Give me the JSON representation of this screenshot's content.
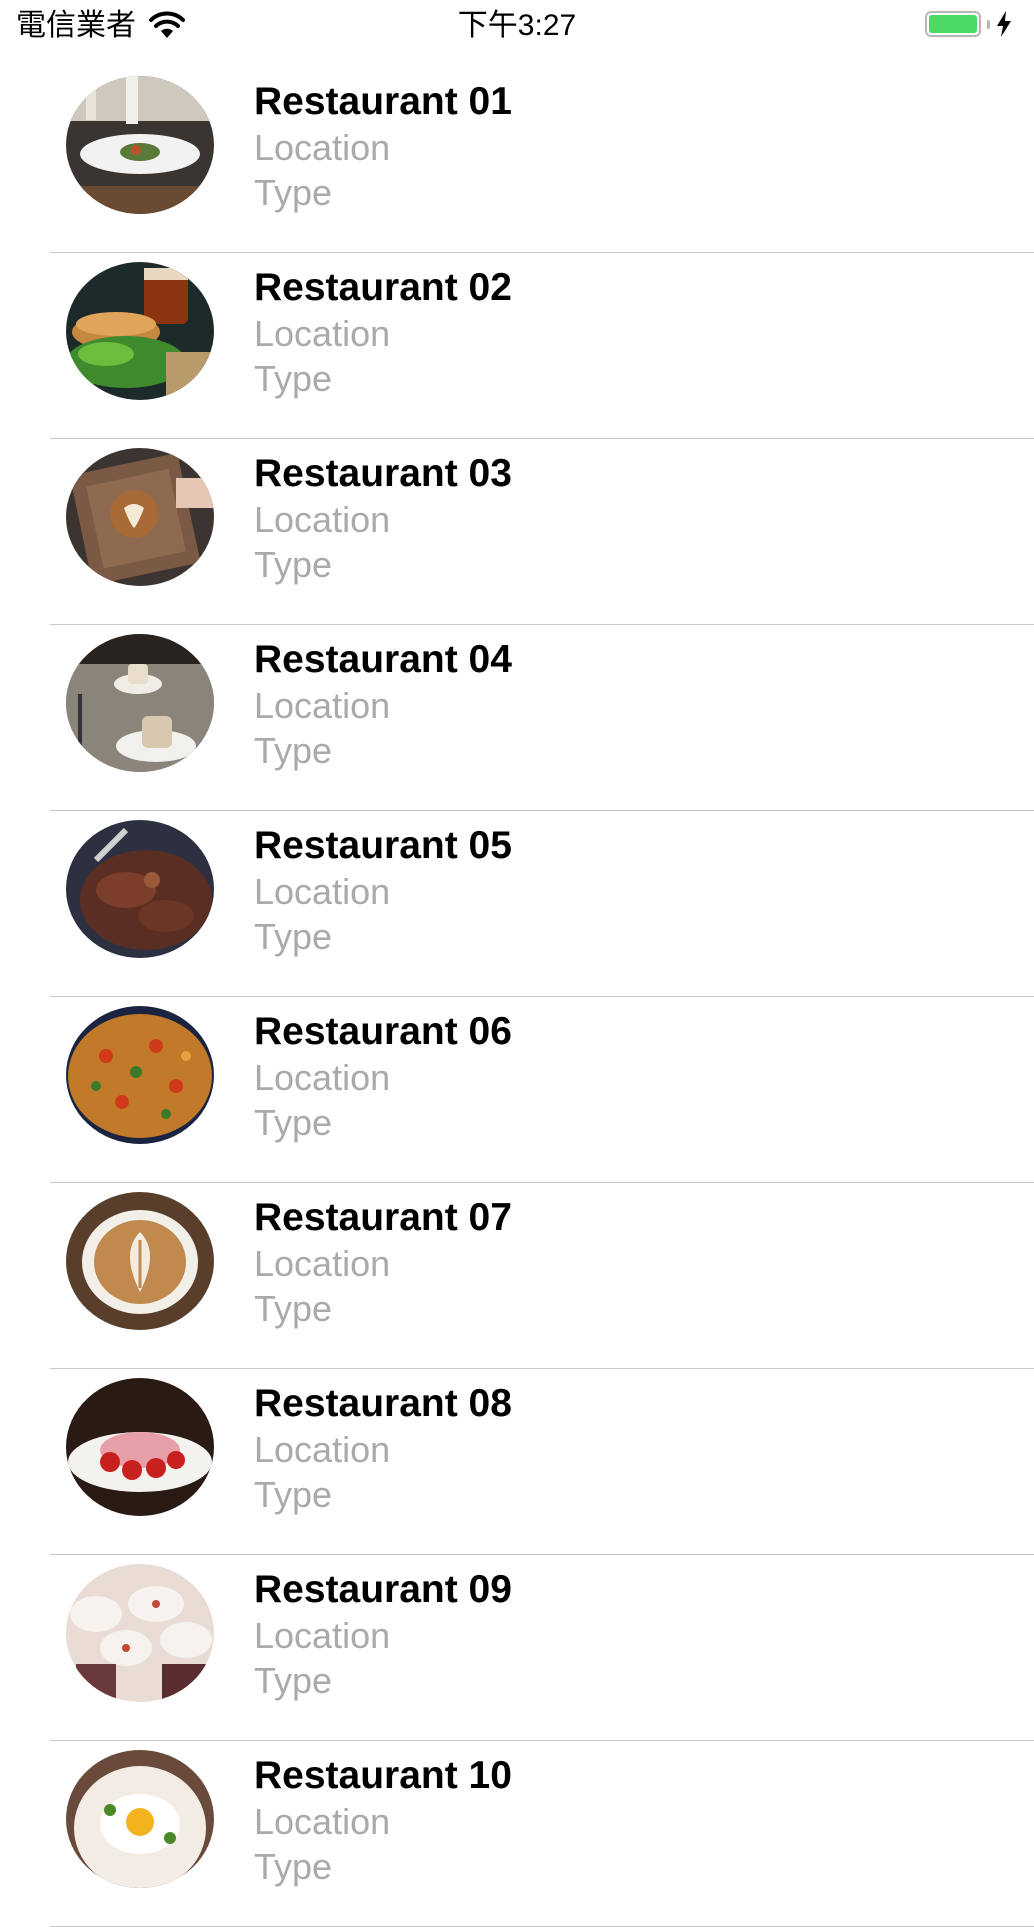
{
  "status_bar": {
    "carrier": "電信業者",
    "time": "下午3:27",
    "battery_color": "#4cd964"
  },
  "restaurants": [
    {
      "name": "Restaurant 01",
      "location": "Location",
      "type": "Type"
    },
    {
      "name": "Restaurant 02",
      "location": "Location",
      "type": "Type"
    },
    {
      "name": "Restaurant 03",
      "location": "Location",
      "type": "Type"
    },
    {
      "name": "Restaurant 04",
      "location": "Location",
      "type": "Type"
    },
    {
      "name": "Restaurant 05",
      "location": "Location",
      "type": "Type"
    },
    {
      "name": "Restaurant 06",
      "location": "Location",
      "type": "Type"
    },
    {
      "name": "Restaurant 07",
      "location": "Location",
      "type": "Type"
    },
    {
      "name": "Restaurant 08",
      "location": "Location",
      "type": "Type"
    },
    {
      "name": "Restaurant 09",
      "location": "Location",
      "type": "Type"
    },
    {
      "name": "Restaurant 10",
      "location": "Location",
      "type": "Type"
    }
  ]
}
